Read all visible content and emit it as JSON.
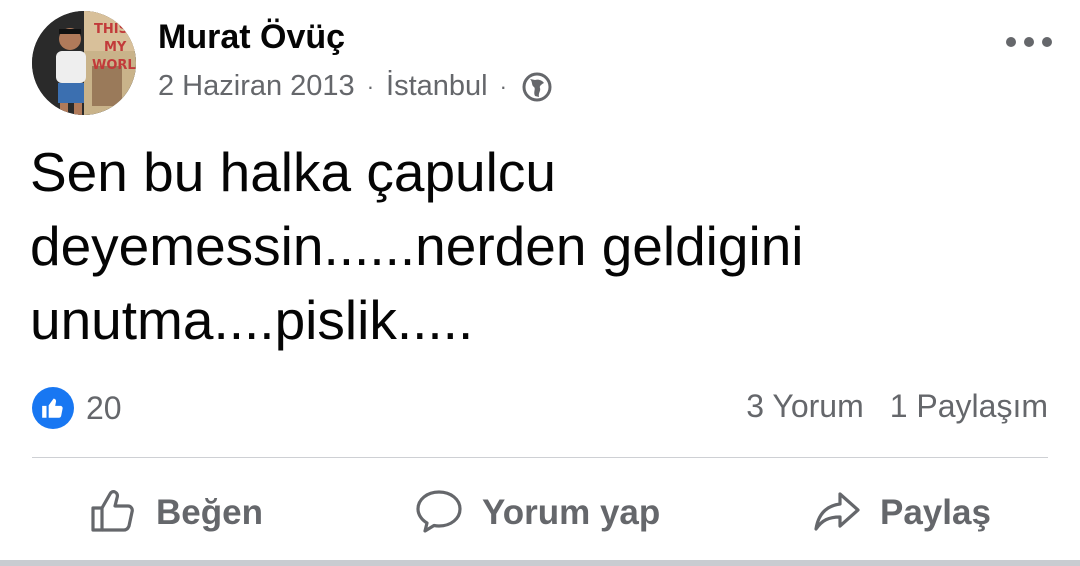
{
  "post": {
    "author": "Murat Övüç",
    "date": "2 Haziran 2013",
    "separator": "·",
    "location": "İstanbul",
    "text_lines": [
      "Sen bu halka çapulcu",
      "deyemessin......nerden geldigini",
      "unutma....pislik....."
    ]
  },
  "avatar_sign": [
    "THIS",
    "MY",
    "WORLD"
  ],
  "stats": {
    "reactions": "20",
    "comments": "3 Yorum",
    "shares": "1 Paylaşım"
  },
  "actions": {
    "like": "Beğen",
    "comment": "Yorum yap",
    "share": "Paylaş"
  },
  "icons": [
    "more-options-icon",
    "globe-icon",
    "like-reaction-icon",
    "thumbs-up-icon",
    "comment-icon",
    "share-icon"
  ],
  "colors": {
    "brand_blue": "#1877f2",
    "secondary_text": "#65676b",
    "divider": "#ced0d4"
  }
}
